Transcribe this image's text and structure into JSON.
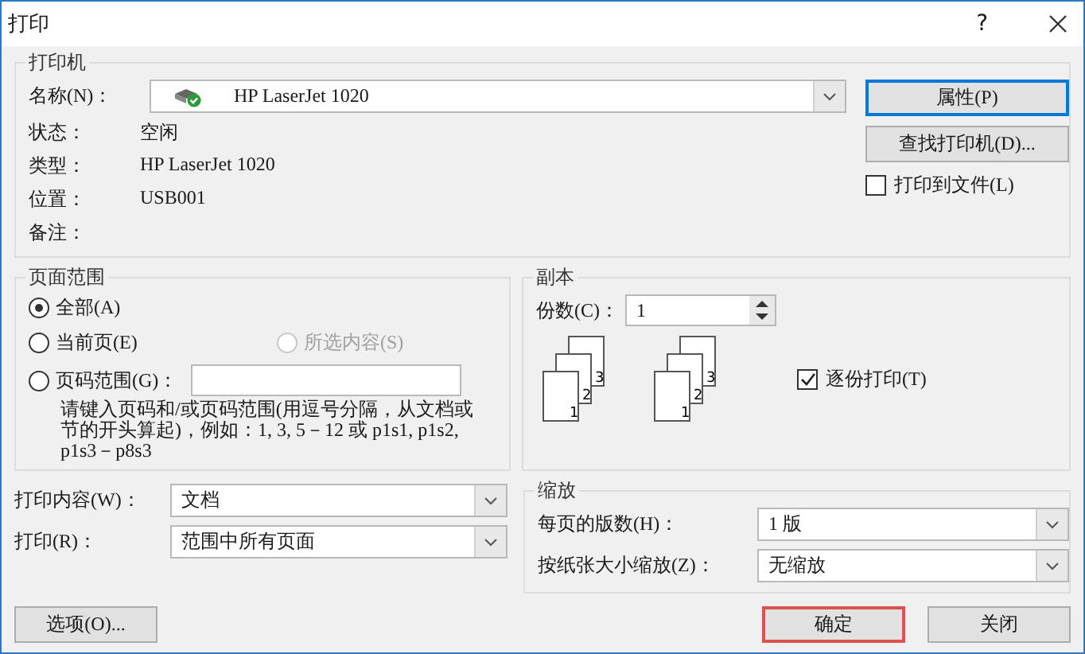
{
  "window": {
    "title": "打印",
    "help": "?"
  },
  "printer": {
    "title": "打印机",
    "name_label": "名称(N)：",
    "name": "HP LaserJet 1020",
    "properties_button": "属性(P)",
    "find_button": "查找打印机(D)...",
    "print_to_file": {
      "label": "打印到文件(L)",
      "checked": false
    },
    "info": [
      {
        "label": "状态：",
        "value": "空闲"
      },
      {
        "label": "类型：",
        "value": "HP LaserJet 1020"
      },
      {
        "label": "位置：",
        "value": "USB001"
      },
      {
        "label": "备注："
      }
    ]
  },
  "page_range": {
    "title": "页面范围",
    "options": [
      {
        "label": "全部(A)",
        "selected": true,
        "disabled": false
      },
      {
        "label": "当前页(E)",
        "selected": false,
        "disabled": false
      },
      {
        "label": "所选内容(S)",
        "selected": false,
        "disabled": true
      },
      {
        "label": "页码范围(G)：",
        "selected": false,
        "disabled": false
      }
    ],
    "hint": "请键入页码和/或页码范围(用逗号分隔，从文档或节的开头算起)，例如：1, 3, 5－12 或 p1s1, p1s2, p1s3－p8s3"
  },
  "copies": {
    "title": "副本",
    "copies_label": "份数(C)：",
    "copies": "1",
    "page_stacks": [
      [
        "1",
        "2",
        "3"
      ],
      [
        "1",
        "2",
        "3"
      ]
    ],
    "collate": {
      "label": "逐份打印(T)",
      "checked": true
    }
  },
  "print_what": {
    "label": "打印内容(W)：",
    "value": "文档"
  },
  "print": {
    "label": "打印(R)：",
    "value": "范围中所有页面"
  },
  "zoom": {
    "title": "缩放",
    "pages_per_sheet": {
      "label": "每页的版数(H)：",
      "value": "1 版"
    },
    "scale": {
      "label": "按纸张大小缩放(Z)：",
      "value": "无缩放"
    }
  },
  "buttons": [
    {
      "label": "选项(O)...",
      "highlighted": false
    },
    {
      "label": "确定",
      "highlighted": true
    },
    {
      "label": "关闭",
      "highlighted": false
    }
  ]
}
